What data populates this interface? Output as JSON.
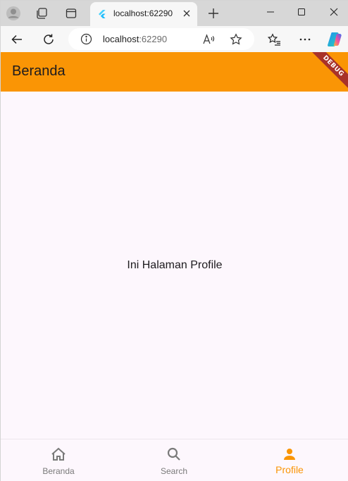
{
  "browser": {
    "tab": {
      "title": "localhost:62290"
    },
    "address": {
      "host": "localhost",
      "port": ":62290"
    }
  },
  "app": {
    "appbar_title": "Beranda",
    "debug_banner": "DEBUG",
    "body_text": "Ini Halaman Profile",
    "accent_color": "#fa9505",
    "bottom_nav": [
      {
        "label": "Beranda",
        "icon": "home-icon",
        "active": false
      },
      {
        "label": "Search",
        "icon": "search-icon",
        "active": false
      },
      {
        "label": "Profile",
        "icon": "person-icon",
        "active": true
      }
    ]
  }
}
